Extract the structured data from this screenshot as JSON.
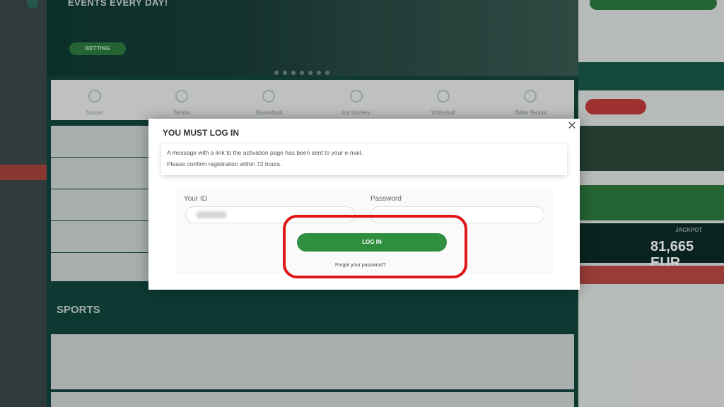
{
  "banner": {
    "title": "EVENTS EVERY DAY!",
    "button_label": "BETTING"
  },
  "sports_tabs": [
    "Soccer",
    "Tennis",
    "Basketball",
    "Ice Hockey",
    "Volleyball",
    "Table Tennis"
  ],
  "sports_heading": "SPORTS",
  "jackpot": {
    "label": "JACKPOT",
    "value": "81,665 EUR"
  },
  "modal": {
    "title": "YOU MUST LOG IN",
    "message_line1": "A message with a link to the activation page has been sent to your e-mail.",
    "message_line2": "Please confirm registration within 72 hours.",
    "id_label": "Your ID",
    "password_label": "Password",
    "login_label": "LOG IN",
    "forgot_label": "Forgot your password?",
    "close_glyph": "✕"
  },
  "colors": {
    "login_button": "#2f8f3e",
    "highlight": "#e01515",
    "page_background": "#12463f"
  }
}
